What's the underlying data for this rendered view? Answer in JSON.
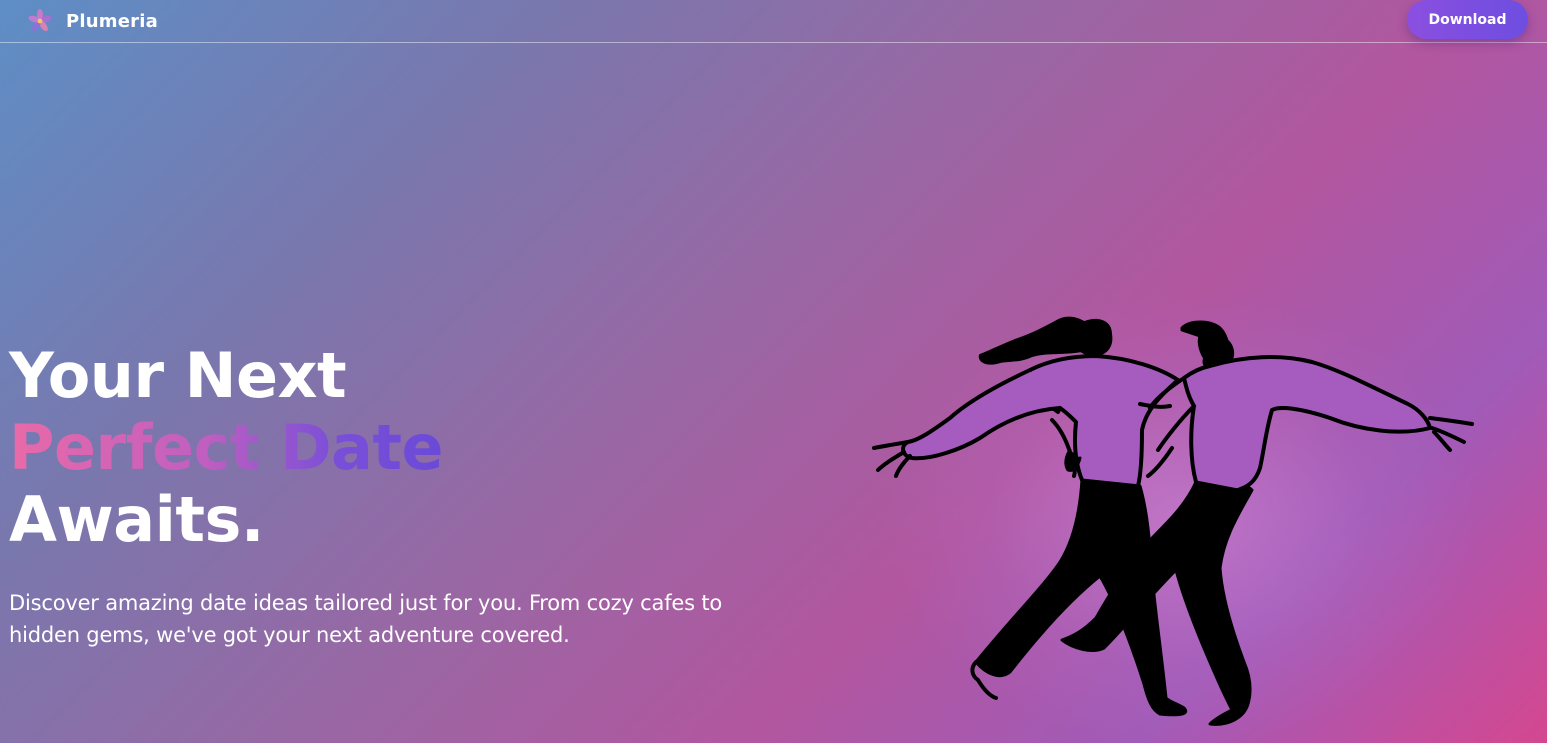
{
  "brand": {
    "name": "Plumeria",
    "icon": "plumeria-flower-icon"
  },
  "nav": {
    "download_label": "Download"
  },
  "hero": {
    "line1": "Your Next",
    "line2": "Perfect Date",
    "line3": "Awaits.",
    "subtitle": "Discover amazing date ideas tailored just for you. From cozy cafes to hidden gems, we've got your next adventure covered."
  },
  "illustration": {
    "subject": "dancing-couple-illustration"
  },
  "colors": {
    "accent_gradient_start": "#e96aa8",
    "accent_gradient_end": "#6a4ad8",
    "button_gradient_start": "#8b4fe0",
    "button_gradient_end": "#6d4ee0",
    "figure_fill": "#a65bbf",
    "text": "#ffffff"
  }
}
